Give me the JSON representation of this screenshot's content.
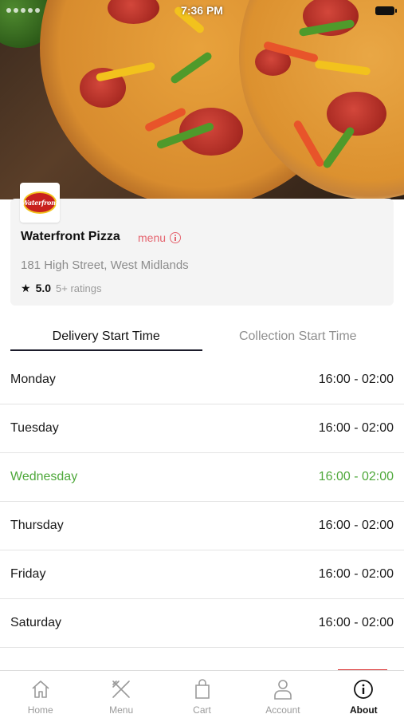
{
  "status_bar": {
    "time": "7:36 PM"
  },
  "restaurant": {
    "name": "Waterfront Pizza",
    "menu_link": "menu",
    "address": "181 High Street, West Midlands",
    "rating_value": "5.0",
    "rating_count": "5+ ratings",
    "logo_text": "Waterfront"
  },
  "tabs": [
    {
      "label": "Delivery Start Time",
      "active": true
    },
    {
      "label": "Collection Start Time",
      "active": false
    }
  ],
  "schedule": [
    {
      "day": "Monday",
      "hours": "16:00 - 02:00",
      "today": false
    },
    {
      "day": "Tuesday",
      "hours": "16:00 - 02:00",
      "today": false
    },
    {
      "day": "Wednesday",
      "hours": "16:00 - 02:00",
      "today": true
    },
    {
      "day": "Thursday",
      "hours": "16:00 - 02:00",
      "today": false
    },
    {
      "day": "Friday",
      "hours": "16:00 - 02:00",
      "today": false
    },
    {
      "day": "Saturday",
      "hours": "16:00 - 02:00",
      "today": false
    }
  ],
  "bottom_nav": [
    {
      "label": "Home",
      "icon": "home-icon",
      "active": false
    },
    {
      "label": "Menu",
      "icon": "cutlery-icon",
      "active": false
    },
    {
      "label": "Cart",
      "icon": "shopping-bag-icon",
      "active": false
    },
    {
      "label": "Account",
      "icon": "person-icon",
      "active": false
    },
    {
      "label": "About",
      "icon": "info-icon",
      "active": true
    }
  ],
  "colors": {
    "accent_menu": "#e5646f",
    "today_green": "#4ea83a",
    "active_tab_underline": "#1b1b2a"
  }
}
